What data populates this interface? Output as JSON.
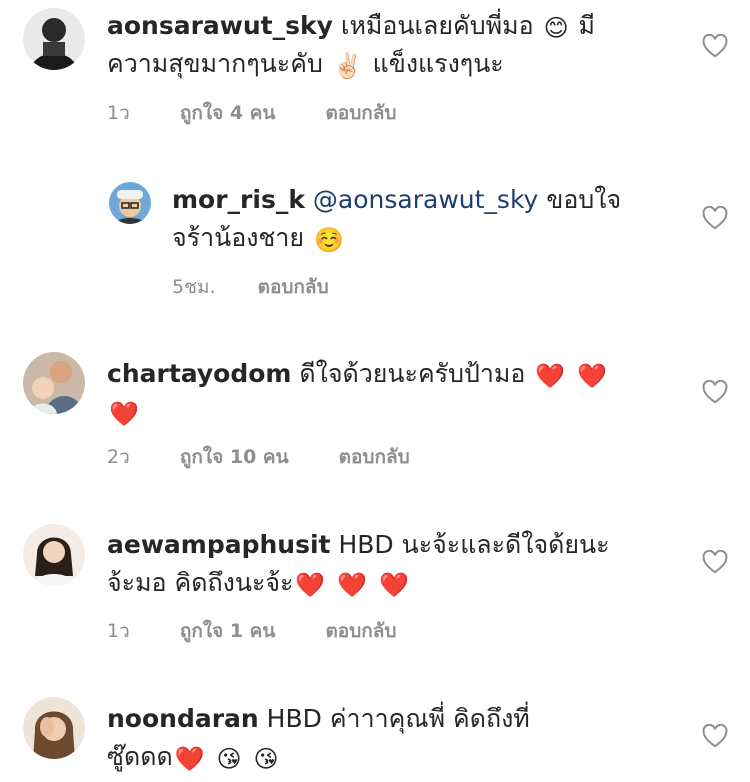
{
  "comments": [
    {
      "username": "aonsarawut_sky",
      "text_before": "เหมือนเลยคับพี่มอ",
      "emoji1": "😊",
      "text_mid": "มีความสุขมากๆนะคับ",
      "emoji2": "✌🏻",
      "text_after": "แข็งแรงๆนะ",
      "time": "1ว",
      "likes": "ถูกใจ 4 คน",
      "reply": "ตอบกลับ",
      "avatar_icon": "user-silhouette"
    },
    {
      "username": "mor_ris_k",
      "mention": "@aonsarawut_sky",
      "text_before": "ขอบใจจร้าน้องชาย",
      "emoji1": "☺️",
      "time": "5ชม.",
      "reply": "ตอบกลับ",
      "avatar_icon": "user-glasses-hat"
    },
    {
      "username": "chartayodom",
      "text_before": "ดีใจด้วยนะครับป้ามอ",
      "emoji1": "❤️",
      "emoji2": "❤️",
      "emoji3": "❤️",
      "time": "2ว",
      "likes": "ถูกใจ 10 คน",
      "reply": "ตอบกลับ",
      "avatar_icon": "user-with-baby"
    },
    {
      "username": "aewampaphusit",
      "text_before": "HBD นะจ้ะและดีใจด้ยนะจ้ะมอ คิดถึงนะจ้ะ",
      "emoji1": "❤️",
      "emoji2": "❤️",
      "emoji3": "❤️",
      "time": "1ว",
      "likes": "ถูกใจ 1 คน",
      "reply": "ตอบกลับ",
      "avatar_icon": "user-woman"
    },
    {
      "username": "noondaran",
      "text_before": "HBD ค่าาาคุณพี่ คิดถึงที่ซู๊ดดด",
      "emoji1": "❤️",
      "emoji2": "😘",
      "emoji3": "😘",
      "avatar_icon": "user-woman-hand"
    }
  ],
  "colors": {
    "text": "#262626",
    "secondary": "#8e8e8e",
    "mention": "#1f3e70",
    "heart_outline": "#8e8e8e"
  },
  "icons": {
    "like": "heart-outline-icon"
  }
}
